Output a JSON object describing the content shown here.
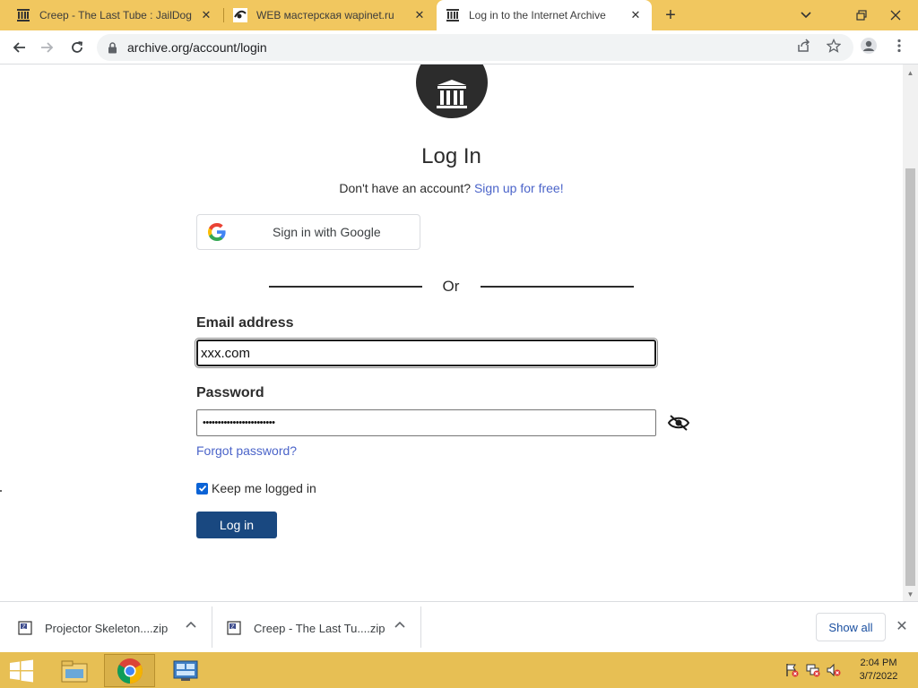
{
  "browser": {
    "tabs": [
      {
        "title": "Creep - The Last Tube : JailDog : ",
        "active": false,
        "favicon": "archive-icon"
      },
      {
        "title": "WEB мастерская wapinet.ru",
        "active": false,
        "favicon": "wapinet-icon"
      },
      {
        "title": "Log in to the Internet Archive",
        "active": true,
        "favicon": "archive-icon"
      }
    ],
    "new_tab": "+",
    "url": "archive.org/account/login"
  },
  "page": {
    "heading": "Log In",
    "signup_prompt": "Don't have an account?",
    "signup_link": "Sign up for free!",
    "google_button": "Sign in with Google",
    "or": "Or",
    "email_label": "Email address",
    "email_value": "xxx.com",
    "password_label": "Password",
    "password_value": "••••••••••••••••••••••••",
    "forgot_link": "Forgot password?",
    "keep_logged_in": "Keep me logged in",
    "keep_logged_in_checked": true,
    "login_button": "Log in"
  },
  "downloads": {
    "items": [
      {
        "name": "Projector Skeleton....zip"
      },
      {
        "name": "Creep - The Last Tu....zip"
      }
    ],
    "show_all": "Show all"
  },
  "taskbar": {
    "time": "2:04 PM",
    "date": "3/7/2022"
  },
  "colors": {
    "tab_strip": "#f1c75f",
    "taskbar": "#e7bf54",
    "link": "#4b64c9",
    "login_button": "#194880",
    "checkbox": "#0b63d6"
  }
}
